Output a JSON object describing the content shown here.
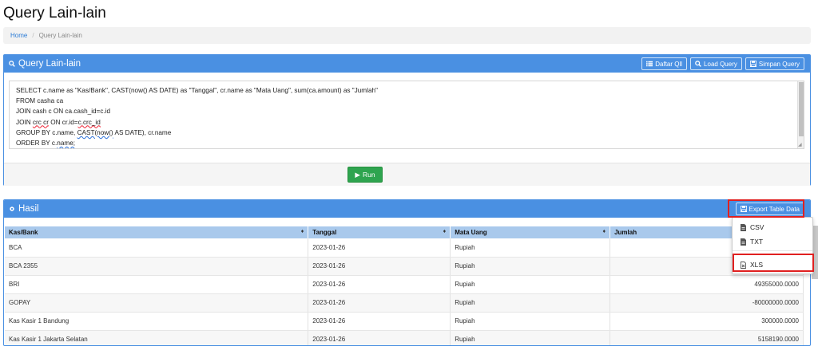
{
  "page": {
    "title": "Query Lain-lain"
  },
  "breadcrumb": {
    "home": "Home",
    "separator": "/",
    "current": "Query Lain-lain"
  },
  "query_panel": {
    "title": "Query Lain-lain",
    "buttons": {
      "daftar": "Daftar Qll",
      "load": "Load Query",
      "simpan": "Simpan Query"
    },
    "sql": {
      "line1": "SELECT c.name as \"Kas/Bank\", CAST(now() AS DATE) as \"Tanggal\", cr.name as \"Mata Uang\", sum(ca.amount) as \"Jumlah\"",
      "line2": "FROM casha ca",
      "line3": "JOIN cash c ON ca.cash_id=c.id",
      "line4_a": "JOIN ",
      "line4_b": "crc cr",
      "line4_c": " ON cr.id=",
      "line4_d": "c.crc_id",
      "line5_a": "GROUP BY c.name, ",
      "line5_b": "CAST(now()",
      "line5_c": " AS DATE), cr.name",
      "line6_a": "ORDER BY c.",
      "line6_b": "name;"
    },
    "run_label": "Run"
  },
  "result_panel": {
    "title": "Hasil",
    "export_label": "Export Table Data",
    "export_menu": {
      "csv": "CSV",
      "txt": "TXT",
      "xls": "XLS"
    },
    "columns": [
      "Kas/Bank",
      "Tanggal",
      "Mata Uang",
      "Jumlah"
    ],
    "rows": [
      [
        "BCA",
        "2023-01-26",
        "Rupiah",
        ""
      ],
      [
        "BCA 2355",
        "2023-01-26",
        "Rupiah",
        ""
      ],
      [
        "BRI",
        "2023-01-26",
        "Rupiah",
        "49355000.0000"
      ],
      [
        "GOPAY",
        "2023-01-26",
        "Rupiah",
        "-80000000.0000"
      ],
      [
        "Kas Kasir 1 Bandung",
        "2023-01-26",
        "Rupiah",
        "300000.0000"
      ],
      [
        "Kas Kasir 1 Jakarta Selatan",
        "2023-01-26",
        "Rupiah",
        "5158190.0000"
      ]
    ]
  },
  "colors": {
    "panel_header": "#4a90e2",
    "table_header": "#a9c9ec",
    "run_button": "#2ea44f",
    "highlight": "#e02020"
  },
  "icons": {
    "search": "search-icon",
    "list": "list-icon",
    "save": "save-icon",
    "play": "play-icon",
    "gear": "gear-icon",
    "file": "file-icon",
    "excel": "excel-file-icon"
  }
}
